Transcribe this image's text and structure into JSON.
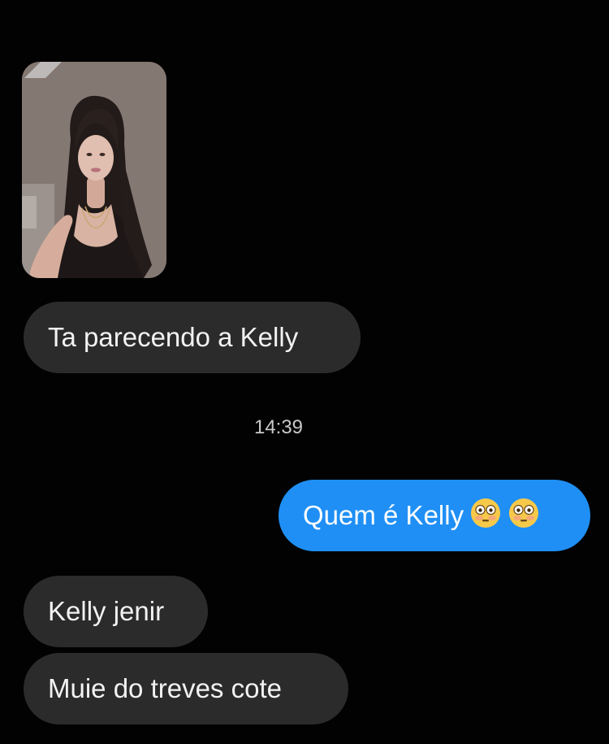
{
  "chat": {
    "messages": [
      {
        "direction": "incoming",
        "type": "image",
        "image_description": "selfie photo"
      },
      {
        "direction": "incoming",
        "type": "text",
        "text": "Ta parecendo a Kelly"
      },
      {
        "direction": "outgoing",
        "type": "text",
        "text": "Quem é Kelly",
        "emoji": [
          "flushed-face-emoji",
          "flushed-face-emoji"
        ]
      },
      {
        "direction": "incoming",
        "type": "text",
        "text": "Kelly jenir"
      },
      {
        "direction": "incoming",
        "type": "text",
        "text": "Muie do treves cote"
      }
    ],
    "timestamp": "14:39"
  },
  "colors": {
    "background": "#020202",
    "incoming_bubble": "#2b2b2b",
    "outgoing_bubble": "#1f8ff5",
    "text_light": "#f2f2f2",
    "timestamp_text": "#c9c9c9"
  }
}
